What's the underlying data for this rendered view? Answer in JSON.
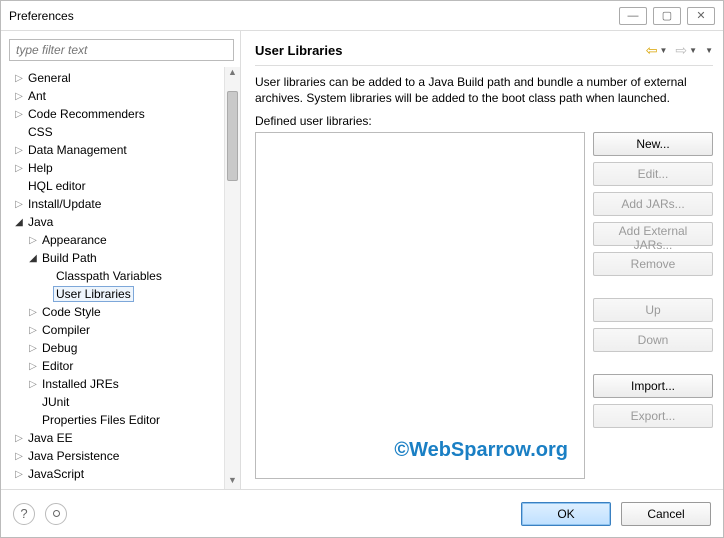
{
  "window": {
    "title": "Preferences"
  },
  "filter": {
    "placeholder": "type filter text"
  },
  "tree": {
    "items": [
      {
        "label": "General",
        "depth": 0,
        "twisty": "right"
      },
      {
        "label": "Ant",
        "depth": 0,
        "twisty": "right"
      },
      {
        "label": "Code Recommenders",
        "depth": 0,
        "twisty": "right"
      },
      {
        "label": "CSS",
        "depth": 0,
        "twisty": "none"
      },
      {
        "label": "Data Management",
        "depth": 0,
        "twisty": "right"
      },
      {
        "label": "Help",
        "depth": 0,
        "twisty": "right"
      },
      {
        "label": "HQL editor",
        "depth": 0,
        "twisty": "none"
      },
      {
        "label": "Install/Update",
        "depth": 0,
        "twisty": "right"
      },
      {
        "label": "Java",
        "depth": 0,
        "twisty": "down"
      },
      {
        "label": "Appearance",
        "depth": 1,
        "twisty": "right"
      },
      {
        "label": "Build Path",
        "depth": 1,
        "twisty": "down"
      },
      {
        "label": "Classpath Variables",
        "depth": 2,
        "twisty": "none"
      },
      {
        "label": "User Libraries",
        "depth": 2,
        "twisty": "none",
        "selected": true
      },
      {
        "label": "Code Style",
        "depth": 1,
        "twisty": "right"
      },
      {
        "label": "Compiler",
        "depth": 1,
        "twisty": "right"
      },
      {
        "label": "Debug",
        "depth": 1,
        "twisty": "right"
      },
      {
        "label": "Editor",
        "depth": 1,
        "twisty": "right"
      },
      {
        "label": "Installed JREs",
        "depth": 1,
        "twisty": "right"
      },
      {
        "label": "JUnit",
        "depth": 1,
        "twisty": "none"
      },
      {
        "label": "Properties Files Editor",
        "depth": 1,
        "twisty": "none"
      },
      {
        "label": "Java EE",
        "depth": 0,
        "twisty": "right"
      },
      {
        "label": "Java Persistence",
        "depth": 0,
        "twisty": "right"
      },
      {
        "label": "JavaScript",
        "depth": 0,
        "twisty": "right"
      }
    ]
  },
  "page": {
    "title": "User Libraries",
    "description": "User libraries can be added to a Java Build path and bundle a number of external archives. System libraries will be added to the boot class path when launched.",
    "defined_label": "Defined user libraries:",
    "watermark": "©WebSparrow.org"
  },
  "buttons": {
    "new": "New...",
    "edit": "Edit...",
    "addjars": "Add JARs...",
    "addext": "Add External JARs...",
    "remove": "Remove",
    "up": "Up",
    "down": "Down",
    "import": "Import...",
    "export": "Export..."
  },
  "footer": {
    "ok": "OK",
    "cancel": "Cancel"
  }
}
